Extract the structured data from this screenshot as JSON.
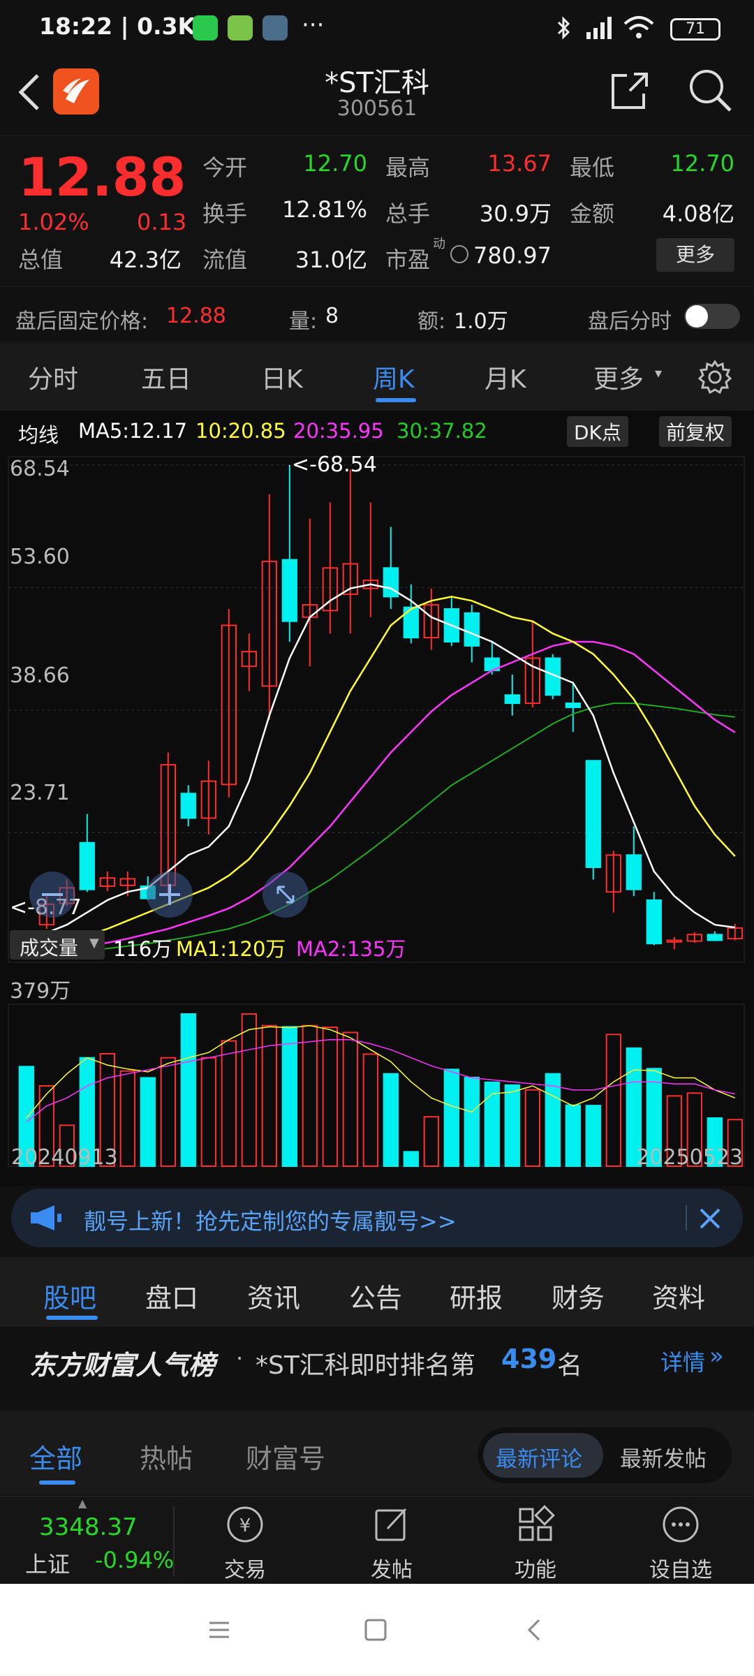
{
  "status_bar": {
    "time": "18:22 | 0.3K/s",
    "dots": "···",
    "battery": "71"
  },
  "header": {
    "title": "*ST汇科",
    "code": "300561"
  },
  "quote": {
    "price": "12.88",
    "change_pct": "1.02%",
    "change_amt": "0.13",
    "fields": [
      {
        "label": "今开",
        "value": "12.70"
      },
      {
        "label": "最高",
        "value": "13.67"
      },
      {
        "label": "最低",
        "value": "12.70"
      },
      {
        "label": "换手",
        "value": "12.81%"
      },
      {
        "label": "总手",
        "value": "30.9万"
      },
      {
        "label": "金额",
        "value": "4.08亿"
      },
      {
        "label": "总值",
        "value": "42.3亿"
      },
      {
        "label": "流值",
        "value": "31.0亿"
      },
      {
        "label": "市盈",
        "value": "780.97"
      }
    ],
    "pe_sup": "动",
    "more_label": "更多"
  },
  "after_hours": {
    "fixed_price_label": "盘后固定价格:",
    "fixed_price": "12.88",
    "vol_label": "量:",
    "vol": "8",
    "amt_label": "额:",
    "amt": "1.0万",
    "timeshare_label": "盘后分时"
  },
  "k_tabs": [
    "分时",
    "五日",
    "日K",
    "周K",
    "月K",
    "更多"
  ],
  "active_k_tab": "周K",
  "ma_bar": {
    "label": "均线",
    "ma5": "MA5:12.17",
    "ma10": "10:20.85",
    "ma20": "20:35.95",
    "ma30": "30:37.82",
    "dk_label": "DK点",
    "adjust_label": "前复权"
  },
  "volume_bar": {
    "label": "成交量",
    "value": "116万",
    "ma1": "MA1:120万",
    "ma2": "MA2:135万",
    "max_label": "379万"
  },
  "colors": {
    "up": "#ff2e2e",
    "down": "#00f0f0",
    "ma5": "#ffffff",
    "ma10": "#ffff33",
    "ma20": "#ff33ff",
    "ma30": "#22aa22",
    "accent": "#3b8cf0"
  },
  "chart_data": {
    "type": "candlestick",
    "x_start": "20240913",
    "x_end": "20250523",
    "price_ticks": [
      "68.54",
      "53.60",
      "38.66",
      "23.71"
    ],
    "ylim": [
      8.77,
      68.54
    ],
    "high_marker": "<-68.54",
    "low_marker": "<-8.77",
    "candles": [
      {
        "o": 9.2,
        "c": 8.9,
        "h": 9.6,
        "l": 8.77
      },
      {
        "o": 12.5,
        "c": 15.0,
        "h": 16.3,
        "l": 12.0
      },
      {
        "o": 15.1,
        "c": 17.0,
        "h": 18.0,
        "l": 14.8
      },
      {
        "o": 22.5,
        "c": 16.8,
        "h": 26.0,
        "l": 16.5
      },
      {
        "o": 17.2,
        "c": 18.2,
        "h": 19.0,
        "l": 16.6
      },
      {
        "o": 17.3,
        "c": 18.1,
        "h": 19.0,
        "l": 16.0
      },
      {
        "o": 17.2,
        "c": 15.7,
        "h": 18.4,
        "l": 15.5
      },
      {
        "o": 17.3,
        "c": 32.0,
        "h": 33.5,
        "l": 16.0
      },
      {
        "o": 28.5,
        "c": 25.5,
        "h": 29.5,
        "l": 24.5
      },
      {
        "o": 25.5,
        "c": 30.0,
        "h": 32.5,
        "l": 23.5
      },
      {
        "o": 29.6,
        "c": 49.0,
        "h": 51.0,
        "l": 28.0
      },
      {
        "o": 44.0,
        "c": 45.8,
        "h": 48.0,
        "l": 41.0
      },
      {
        "o": 41.6,
        "c": 56.8,
        "h": 65.0,
        "l": 37.5
      },
      {
        "o": 57.0,
        "c": 49.5,
        "h": 68.54,
        "l": 47.0
      },
      {
        "o": 50.0,
        "c": 51.5,
        "h": 62.0,
        "l": 44.0
      },
      {
        "o": 50.8,
        "c": 56.0,
        "h": 64.0,
        "l": 48.0
      },
      {
        "o": 52.8,
        "c": 56.5,
        "h": 68.0,
        "l": 48.0
      },
      {
        "o": 53.5,
        "c": 54.5,
        "h": 64.0,
        "l": 50.0
      },
      {
        "o": 56.0,
        "c": 52.5,
        "h": 61.0,
        "l": 51.0
      },
      {
        "o": 51.2,
        "c": 47.5,
        "h": 54.0,
        "l": 46.8
      },
      {
        "o": 47.5,
        "c": 51.5,
        "h": 53.5,
        "l": 46.0
      },
      {
        "o": 51.0,
        "c": 47.0,
        "h": 52.5,
        "l": 46.5
      },
      {
        "o": 50.5,
        "c": 46.5,
        "h": 51.5,
        "l": 44.5
      },
      {
        "o": 45.0,
        "c": 43.5,
        "h": 47.0,
        "l": 43.0
      },
      {
        "o": 40.5,
        "c": 39.5,
        "h": 43.0,
        "l": 38.0
      },
      {
        "o": 39.5,
        "c": 45.0,
        "h": 49.5,
        "l": 39.0
      },
      {
        "o": 45.0,
        "c": 40.5,
        "h": 45.5,
        "l": 40.0
      },
      {
        "o": 39.5,
        "c": 39.0,
        "h": 42.0,
        "l": 36.0
      },
      {
        "o": 32.5,
        "c": 19.5,
        "h": 32.5,
        "l": 18.0
      },
      {
        "o": 16.5,
        "c": 21.0,
        "h": 21.5,
        "l": 14.0
      },
      {
        "o": 21.0,
        "c": 16.8,
        "h": 24.5,
        "l": 16.0
      },
      {
        "o": 15.5,
        "c": 10.2,
        "h": 16.5,
        "l": 10.0
      },
      {
        "o": 10.4,
        "c": 10.6,
        "h": 11.0,
        "l": 9.5
      },
      {
        "o": 10.5,
        "c": 11.3,
        "h": 11.6,
        "l": 10.3
      },
      {
        "o": 11.3,
        "c": 10.6,
        "h": 11.7,
        "l": 10.5
      },
      {
        "o": 10.8,
        "c": 12.1,
        "h": 12.6,
        "l": 10.6
      }
    ],
    "ma5": [
      10.5,
      11.5,
      12.5,
      14.0,
      15.5,
      16.5,
      17.0,
      19.0,
      21.0,
      22.0,
      24.5,
      30.0,
      38.0,
      45.0,
      50.0,
      52.0,
      53.5,
      54.0,
      53.5,
      52.0,
      50.0,
      49.0,
      48.0,
      47.0,
      45.5,
      44.0,
      43.0,
      42.0,
      38.0,
      31.0,
      25.0,
      19.0,
      16.0,
      14.0,
      12.5,
      12.17
    ],
    "ma10": [
      9.5,
      10.0,
      10.6,
      11.2,
      12.0,
      13.0,
      14.0,
      15.0,
      16.0,
      17.0,
      18.5,
      20.5,
      23.5,
      27.0,
      31.0,
      36.0,
      41.0,
      45.0,
      49.0,
      51.0,
      52.0,
      52.5,
      52.0,
      51.0,
      50.0,
      49.5,
      48.0,
      47.0,
      45.5,
      43.0,
      40.0,
      36.0,
      31.5,
      27.0,
      23.5,
      20.85
    ],
    "ma20": [
      9.0,
      9.2,
      9.5,
      9.9,
      10.3,
      10.8,
      11.4,
      12.0,
      12.8,
      13.6,
      14.5,
      15.8,
      17.5,
      19.5,
      22.0,
      24.5,
      27.5,
      30.5,
      33.5,
      36.0,
      38.5,
      40.5,
      42.0,
      43.5,
      44.5,
      45.5,
      46.5,
      47.0,
      47.0,
      46.5,
      45.5,
      43.5,
      41.5,
      39.5,
      37.5,
      35.95
    ],
    "ma30": [
      9.0,
      9.1,
      9.2,
      9.4,
      9.6,
      9.9,
      10.2,
      10.6,
      11.0,
      11.5,
      12.0,
      12.8,
      13.8,
      15.0,
      16.5,
      18.0,
      19.8,
      21.6,
      23.5,
      25.5,
      27.5,
      29.5,
      31.0,
      32.5,
      34.0,
      35.5,
      37.0,
      38.2,
      39.0,
      39.5,
      39.5,
      39.2,
      38.9,
      38.5,
      38.1,
      37.82
    ],
    "volume": [
      248,
      200,
      102,
      270,
      280,
      237,
      220,
      270,
      379,
      270,
      312,
      379,
      350,
      347,
      350,
      346,
      333,
      279,
      230,
      36,
      123,
      241,
      221,
      209,
      202,
      190,
      230,
      152,
      151,
      328,
      294,
      243,
      175,
      182,
      120,
      116
    ],
    "vol_ma1": [
      120,
      180,
      230,
      270,
      252,
      242,
      235,
      256,
      270,
      283,
      315,
      340,
      347,
      345,
      350,
      340,
      320,
      290,
      260,
      210,
      170,
      150,
      135,
      180,
      185,
      200,
      175,
      150,
      170,
      210,
      240,
      238,
      220,
      220,
      190,
      170
    ],
    "vol_ma2": [
      110,
      150,
      170,
      200,
      220,
      230,
      240,
      250,
      260,
      270,
      280,
      290,
      300,
      305,
      310,
      315,
      315,
      305,
      290,
      270,
      250,
      235,
      220,
      215,
      210,
      205,
      200,
      190,
      190,
      200,
      210,
      210,
      205,
      205,
      190,
      180
    ]
  },
  "banner": {
    "text": "靓号上新！抢先定制您的专属靓号>>"
  },
  "sections": [
    "股吧",
    "盘口",
    "资讯",
    "公告",
    "研报",
    "财务",
    "资料"
  ],
  "active_section": "股吧",
  "rank": {
    "brand": "东方财富人气榜",
    "sep": "·",
    "text_pre": "*ST汇科即时排名第",
    "rank": "439",
    "text_post": "名",
    "detail": "详情"
  },
  "feed_tabs": [
    "全部",
    "热帖",
    "财富号"
  ],
  "feed_sort": [
    "最新评论",
    "最新发帖"
  ],
  "index": {
    "value": "3348.37",
    "name": "上证",
    "change": "-0.94%"
  },
  "bottom_nav": [
    "交易",
    "发帖",
    "功能",
    "设自选"
  ]
}
